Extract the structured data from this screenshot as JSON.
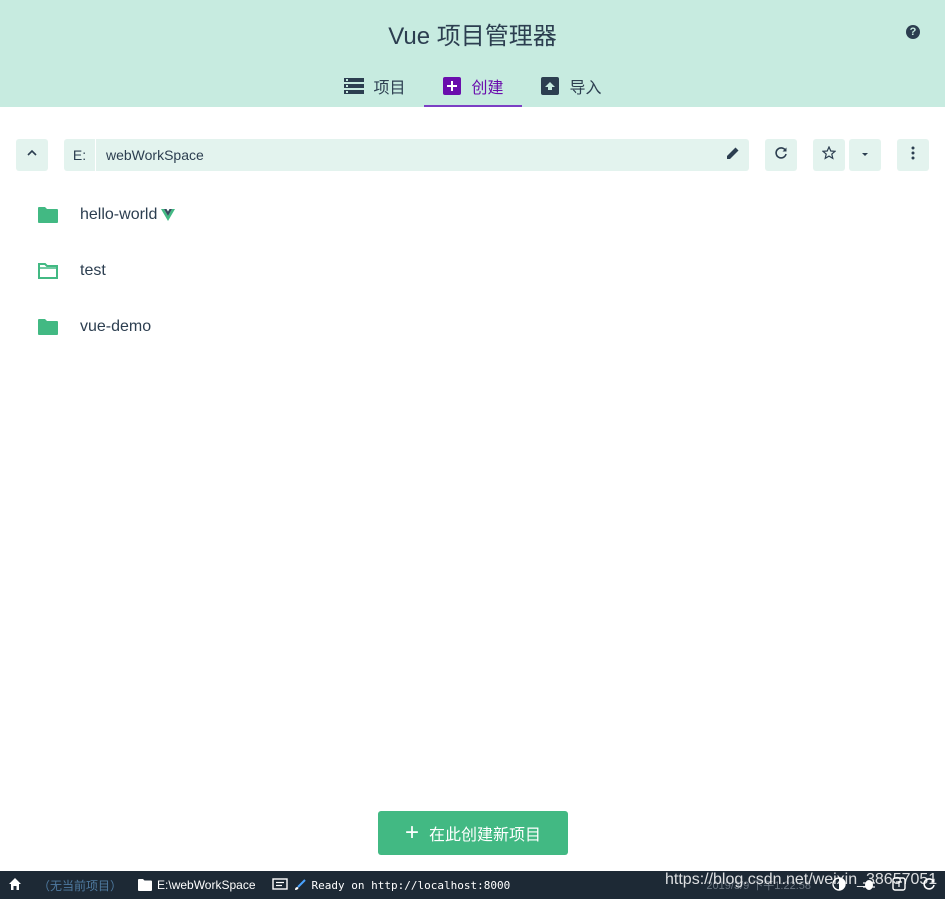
{
  "header": {
    "title": "Vue 项目管理器",
    "help_icon": "help-circle-icon",
    "tabs": [
      {
        "label": "项目",
        "icon": "list-icon",
        "active": false
      },
      {
        "label": "创建",
        "icon": "add-box-icon",
        "active": true
      },
      {
        "label": "导入",
        "icon": "unarchive-icon",
        "active": false
      }
    ]
  },
  "toolbar": {
    "up_icon": "chevron-up-icon",
    "drive": "E:",
    "path": "webWorkSpace",
    "edit_icon": "pencil-icon",
    "refresh_icon": "refresh-icon",
    "favorite_icon": "star-outline-icon",
    "favorites_menu_icon": "arrow-drop-down-icon",
    "more_icon": "more-vertical-icon"
  },
  "folders": [
    {
      "name": "hello-world",
      "icon": "folder-filled-icon",
      "vue_project": true
    },
    {
      "name": "test",
      "icon": "folder-outline-icon",
      "vue_project": false
    },
    {
      "name": "vue-demo",
      "icon": "folder-filled-icon",
      "vue_project": false
    }
  ],
  "create_button": {
    "label": "在此创建新项目",
    "icon": "plus-icon"
  },
  "statusbar": {
    "home_icon": "home-icon",
    "current_project": "（无当前项目）",
    "folder_icon": "folder-icon",
    "cwd": "E:\\webWorkSpace",
    "log_icon": "message-icon",
    "log_text": "Ready on http://localhost:8000",
    "time": "2019/3/9 下午1:22:58",
    "watermark": "https://blog.csdn.net/weixin_38657051"
  },
  "colors": {
    "header_bg": "#c7ebe0",
    "accent": "#42b983",
    "active_tab": "#6a0dad",
    "toolbar_bg": "#e3f3ee",
    "statusbar_bg": "#1d2935",
    "text": "#2c3e50"
  }
}
